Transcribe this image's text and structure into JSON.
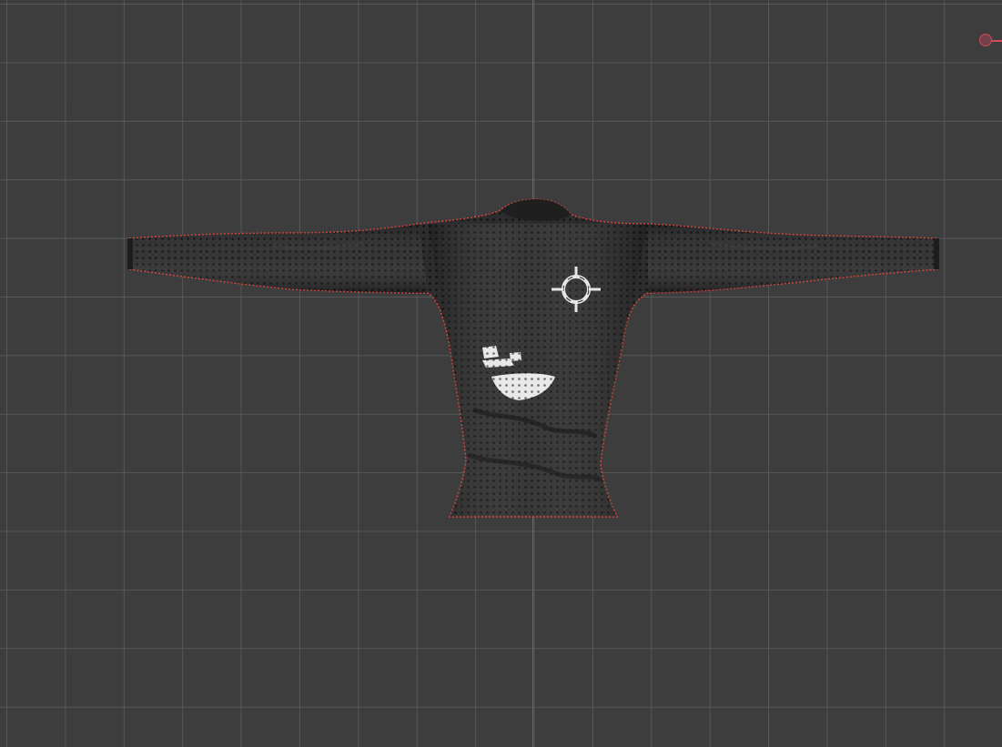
{
  "viewport": {
    "background": "#3d3d3d",
    "grid_color": "#5a5a5a",
    "axis_z_color": "#3b6fb8",
    "axis_x_color": "#d6485f"
  },
  "mesh": {
    "object": "long-sleeve-shirt",
    "shade_color": "#2a2a2a",
    "vertex_color": "#111111",
    "selected_outline_color": "#e0453a",
    "highlight_color": "#e6e6e6"
  },
  "icons": {
    "cursor": "3d-cursor-icon",
    "gizmo": "x-axis-gizmo-handle"
  }
}
